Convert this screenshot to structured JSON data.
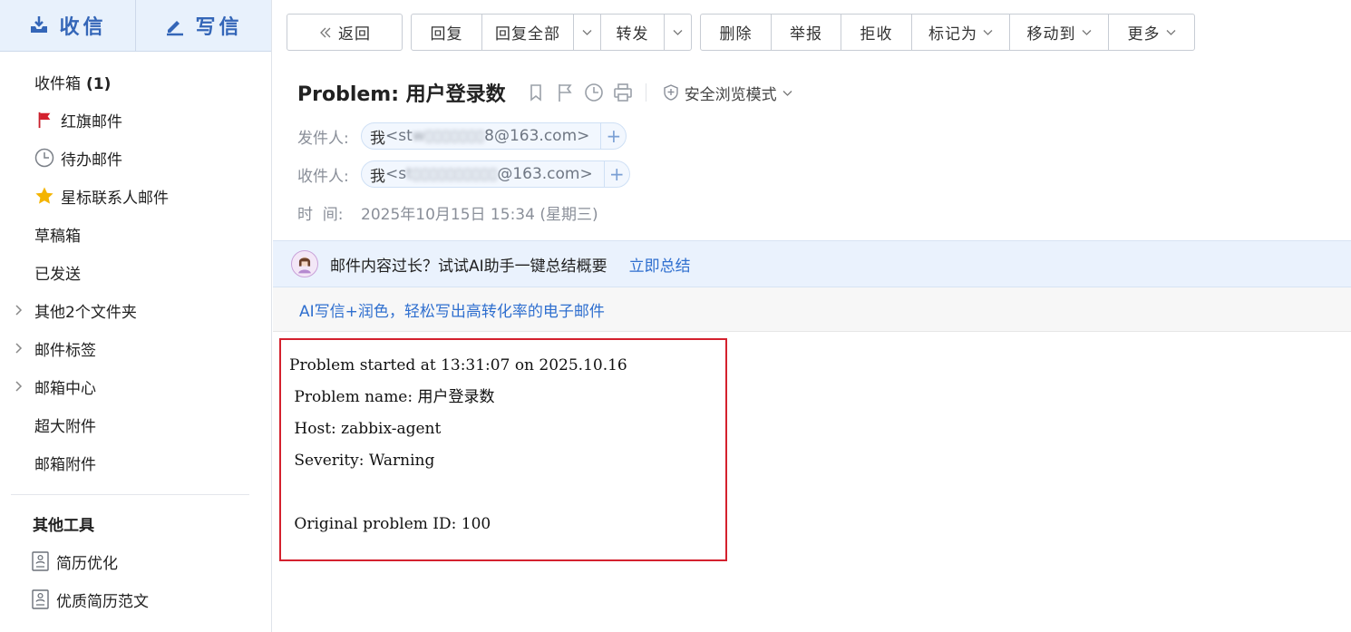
{
  "sidebar": {
    "inbox_label": "收信",
    "compose_label": "写信",
    "nav": [
      {
        "label": "收件箱",
        "count": "(1)"
      },
      {
        "label": "红旗邮件"
      },
      {
        "label": "待办邮件"
      },
      {
        "label": "星标联系人邮件"
      },
      {
        "label": "草稿箱"
      },
      {
        "label": "已发送"
      },
      {
        "label": "其他2个文件夹"
      },
      {
        "label": "邮件标签"
      },
      {
        "label": "邮箱中心"
      },
      {
        "label": "超大附件"
      },
      {
        "label": "邮箱附件"
      }
    ],
    "tools_title": "其他工具",
    "tools": [
      {
        "label": "简历优化"
      },
      {
        "label": "优质简历范文"
      }
    ]
  },
  "toolbar": {
    "back": "返回",
    "reply": "回复",
    "reply_all": "回复全部",
    "forward": "转发",
    "delete": "删除",
    "report": "举报",
    "reject": "拒收",
    "mark_as": "标记为",
    "move_to": "移动到",
    "more": "更多"
  },
  "message": {
    "subject": "Problem: 用户登录数",
    "safe_mode": "安全浏览模式",
    "from_label": "发件人:",
    "from_name": "我",
    "from_email_prefix": "<st",
    "from_email_masked": "w▯▯▯▯▯▯▯",
    "from_email_suffix": "8@163.com>",
    "to_label": "收件人:",
    "to_name": "我",
    "to_email_prefix": "<s",
    "to_email_masked": "t▯▯▯▯▯▯▯▯▯▯",
    "to_email_suffix": "@163.com>",
    "time_label": "时  间:",
    "time_value": "2025年10月15日 15:34 (星期三)"
  },
  "ai": {
    "banner_text": "邮件内容过长？试试AI助手一键总结概要",
    "banner_link": "立即总结",
    "write_link": "AI写信+润色，轻松写出高转化率的电子邮件"
  },
  "body": {
    "lines": [
      "Problem started at 13:31:07 on 2025.10.16",
      " Problem name: 用户登录数",
      " Host: zabbix-agent",
      " Severity: Warning",
      "",
      " Original problem ID: 100"
    ]
  },
  "colors": {
    "accent": "#3466b8",
    "link": "#2f6fcf",
    "highlight_border": "#d4212e",
    "flag": "#d4212e",
    "star": "#f4b400"
  }
}
